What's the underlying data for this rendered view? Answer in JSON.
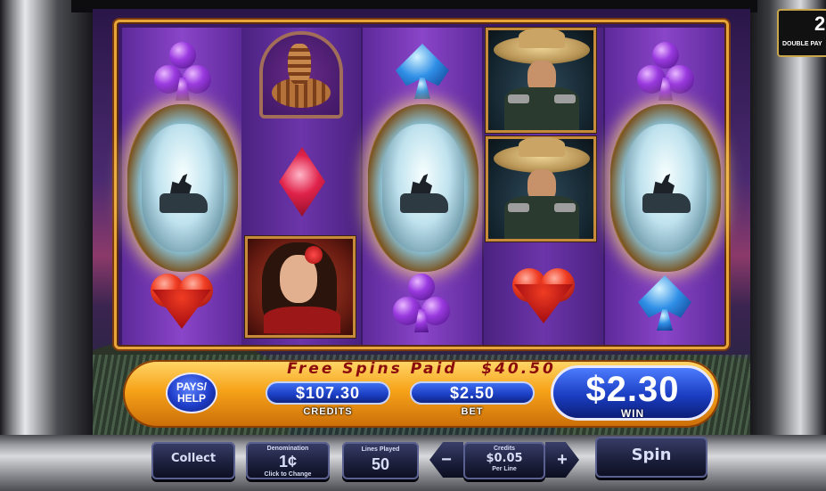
{
  "info_bar": {
    "free_spins_text": "Free Spins Paid   $40.50",
    "pays_help_label": "PAYS/\nHELP",
    "credits_value": "$107.30",
    "credits_label": "CREDITS",
    "bet_value": "$2.50",
    "bet_label": "BET",
    "win_value": "$2.30",
    "win_label": "WIN"
  },
  "corner_widget": {
    "number": "2",
    "label": "DOUBLE PAY"
  },
  "buttons": {
    "collect": "Collect",
    "denomination_title": "Denomination",
    "denomination_value": "1¢",
    "denomination_hint": "Click to Change",
    "lines_title": "Lines Played",
    "lines_value": "50",
    "minus": "−",
    "credits_title": "Credits",
    "credits_value": "$0.05",
    "credits_hint": "Per Line",
    "plus": "+",
    "spin": "Spin"
  },
  "reels": [
    [
      "purple-club",
      "moon-wolf",
      "red-heart"
    ],
    [
      "rattlesnake",
      "red-diamond",
      "senorita"
    ],
    [
      "blue-spade",
      "moon-wolf",
      "purple-club"
    ],
    [
      "bandit",
      "bandit",
      "red-heart"
    ],
    [
      "purple-club",
      "moon-wolf",
      "blue-spade"
    ]
  ],
  "colors": {
    "frame_gold": "#e8a53a",
    "reel_purple": "#8a45c8",
    "panel_orange": "#f7a319",
    "button_blue": "#1b3dc2",
    "free_spins_red": "#8a0c0c"
  }
}
